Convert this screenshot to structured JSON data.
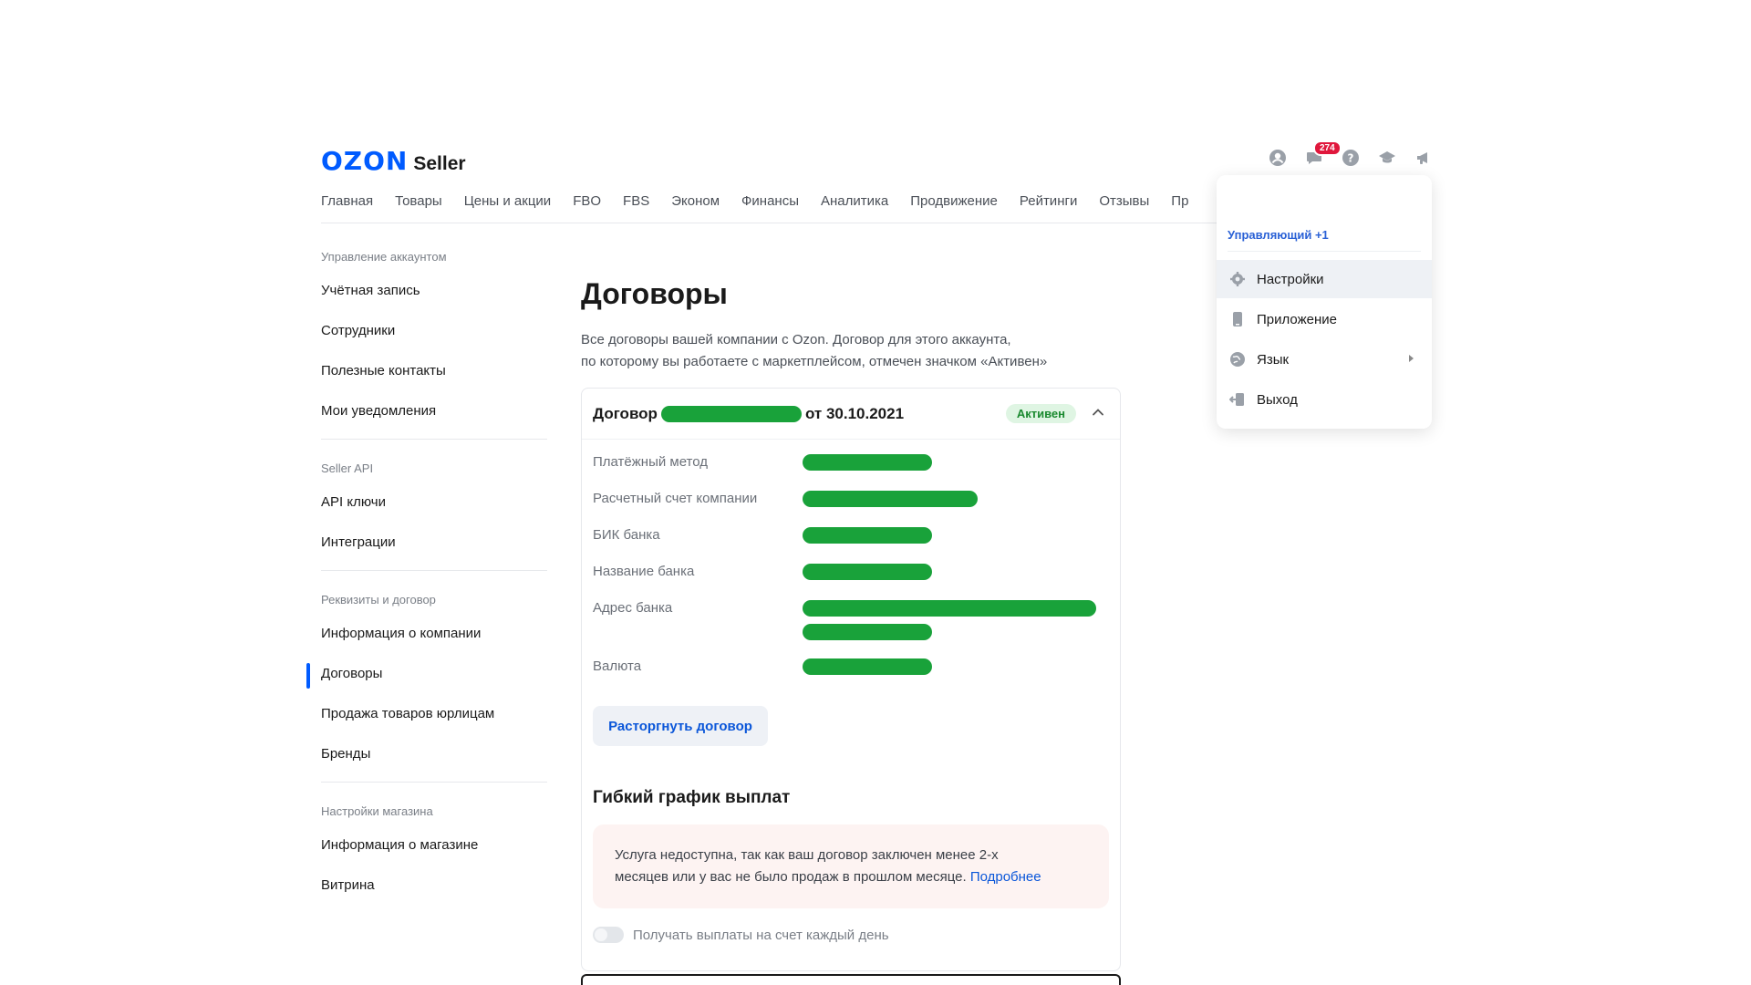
{
  "header": {
    "logo_brand": "OZON",
    "logo_product": "Seller",
    "notification_count": "274"
  },
  "nav": {
    "items": [
      "Главная",
      "Товары",
      "Цены и акции",
      "FBO",
      "FBS",
      "Эконом",
      "Финансы",
      "Аналитика",
      "Продвижение",
      "Рейтинги",
      "Отзывы",
      "Пр"
    ]
  },
  "sidebar": {
    "sections": [
      {
        "title": "Управление аккаунтом",
        "items": [
          "Учётная запись",
          "Сотрудники",
          "Полезные контакты",
          "Мои уведомления"
        ]
      },
      {
        "title": "Seller API",
        "items": [
          "API ключи",
          "Интеграции"
        ]
      },
      {
        "title": "Реквизиты и договор",
        "items": [
          "Информация о компании",
          "Договоры",
          "Продажа товаров юрлицам",
          "Бренды"
        ]
      },
      {
        "title": "Настройки магазина",
        "items": [
          "Информация о магазине",
          "Витрина"
        ]
      }
    ],
    "active_item": "Договоры"
  },
  "main": {
    "title": "Договоры",
    "description_line1": "Все договоры вашей компании с Ozon. Договор для этого аккаунта,",
    "description_line2": "по которому вы работаете с маркетплейсом, отмечен значком «Активен»",
    "contract": {
      "label": "Договор",
      "date_text": "от 30.10.2021",
      "status": "Активен",
      "fields": [
        {
          "label": "Платёжный метод"
        },
        {
          "label": "Расчетный счет компании"
        },
        {
          "label": "БИК банка"
        },
        {
          "label": "Название банка"
        },
        {
          "label": "Адрес банка"
        },
        {
          "label": "Валюта"
        }
      ],
      "terminate_button": "Расторгнуть договор"
    },
    "flex_payments": {
      "title": "Гибкий график выплат",
      "notice_line1": "Услуга недоступна, так как ваш договор заключен менее 2-х",
      "notice_line2": "месяцев или у вас не было продаж в прошлом месяце.",
      "notice_link": "Подробнее",
      "toggle_label": "Получать выплаты на счет каждый день"
    }
  },
  "dropdown": {
    "role": "Управляющий +1",
    "items": [
      {
        "label": "Настройки",
        "icon": "gear-icon"
      },
      {
        "label": "Приложение",
        "icon": "phone-icon"
      },
      {
        "label": "Язык",
        "icon": "globe-icon"
      },
      {
        "label": "Выход",
        "icon": "logout-icon"
      }
    ]
  },
  "colors": {
    "brand": "#005bff",
    "redaction": "#19a23a",
    "status_bg": "#dff5e3",
    "badge": "#e0173c"
  }
}
